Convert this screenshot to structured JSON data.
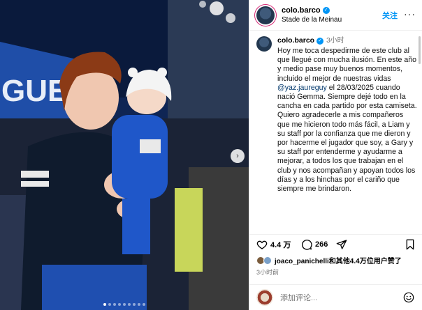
{
  "post": {
    "username": "colo.barco",
    "location": "Stade de la Meinau",
    "follow_label": "关注",
    "more_label": "···",
    "caption_time": "3小时",
    "caption_parts": {
      "before_mention": "Hoy me toca despedirme de este club al que llegué con mucha ilusión. En este año y medio pase muy buenos momentos, incluido el mejor de nuestras vidas ",
      "mention": "@yaz.jaureguy",
      "after_mention": " el 28/03/2025 cuando nació Gemma. Siempre dejé todo en la cancha en cada partido por esta camiseta. Quiero agradecerle a mis compañeros que me hicieron todo más fácil, a Liam y su staff por la confianza que me dieron y por hacerme el jugador que soy, a Gary y su staff por entenderme y ayudarme a mejorar, a todos los que trabajan en el club y nos acompañan y apoyan todos los días y a los hinchas por el cariño que siempre me brindaron."
    },
    "likes_count": "4.4 万",
    "comments_count": "266",
    "liked_by_user": "joaco_panichelli",
    "liked_by_rest": "和其他4.4万位用户赞了",
    "post_time": "3小时前",
    "comment_placeholder": "添加评论..."
  },
  "media": {
    "next_icon": "chevron-right-icon",
    "slide_count": 9,
    "active_slide": 1,
    "banner_text": "GUE"
  },
  "colors": {
    "accent": "#0095f6",
    "mention": "#00376b"
  }
}
